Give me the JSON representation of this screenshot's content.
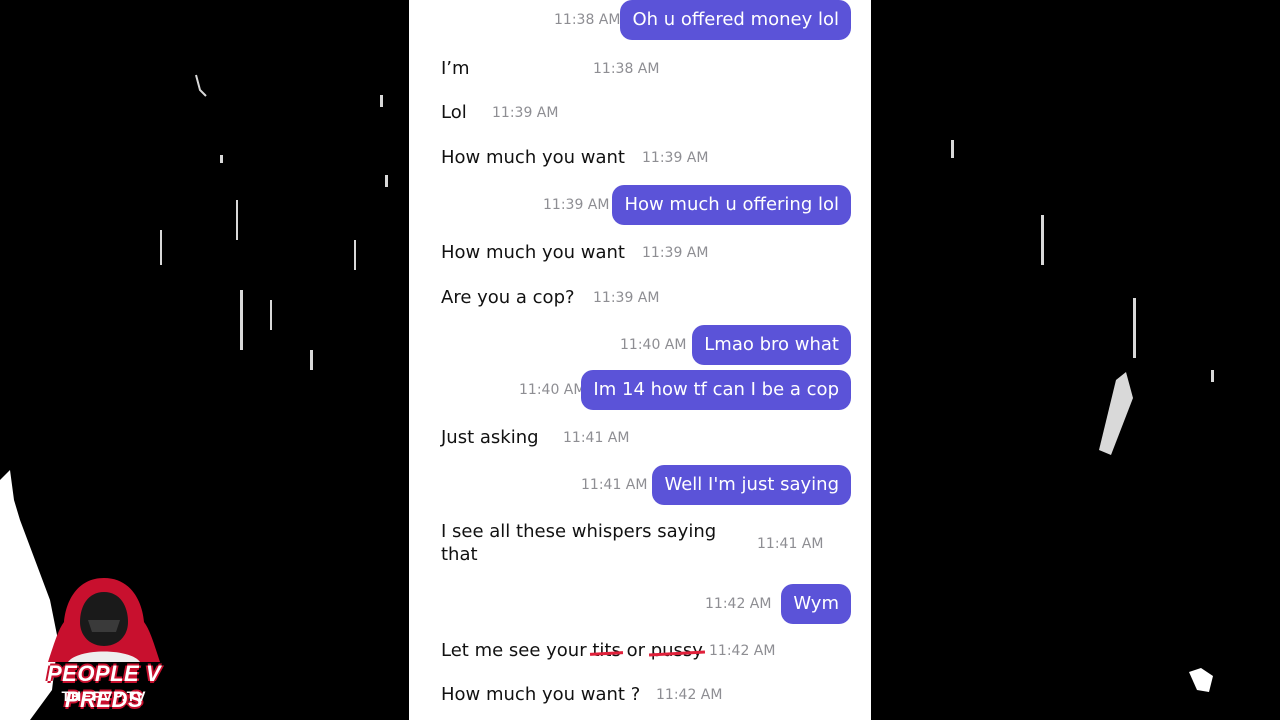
{
  "brand": {
    "title": "PEOPLE V PREDS",
    "subtitle": "THEPVP.TV",
    "accent_color": "#c8102e"
  },
  "chat": {
    "bubble_color": "#5b53d8",
    "messages": [
      {
        "dir": "out",
        "text": "Oh u offered money lol",
        "time": "11:38 AM"
      },
      {
        "dir": "in",
        "text": "I’m",
        "time": "11:38 AM"
      },
      {
        "dir": "in",
        "text": "Lol",
        "time": "11:39 AM"
      },
      {
        "dir": "in",
        "text": "How much you want",
        "time": "11:39 AM"
      },
      {
        "dir": "out",
        "text": "How much u offering lol",
        "time": "11:39 AM"
      },
      {
        "dir": "in",
        "text": "How much you want",
        "time": "11:39 AM"
      },
      {
        "dir": "in",
        "text": "Are you a cop?",
        "time": "11:39 AM"
      },
      {
        "dir": "out",
        "text": "Lmao bro what",
        "time": "11:40 AM"
      },
      {
        "dir": "out",
        "text": "Im 14 how tf can I be a cop",
        "time": "11:40 AM"
      },
      {
        "dir": "in",
        "text": "Just asking",
        "time": "11:41 AM"
      },
      {
        "dir": "out",
        "text": "Well I'm just saying",
        "time": "11:41 AM"
      },
      {
        "dir": "in",
        "text": "I see all these whispers saying that",
        "time": "11:41 AM"
      },
      {
        "dir": "out",
        "text": "Wym",
        "time": "11:42 AM"
      },
      {
        "dir": "in",
        "text_parts": [
          "Let me see your ",
          "tits",
          " or ",
          "pussy"
        ],
        "censored_parts": [
          1,
          3
        ],
        "time": "11:42 AM"
      },
      {
        "dir": "in",
        "text": "How much you want ?",
        "time": "11:42 AM"
      }
    ]
  }
}
